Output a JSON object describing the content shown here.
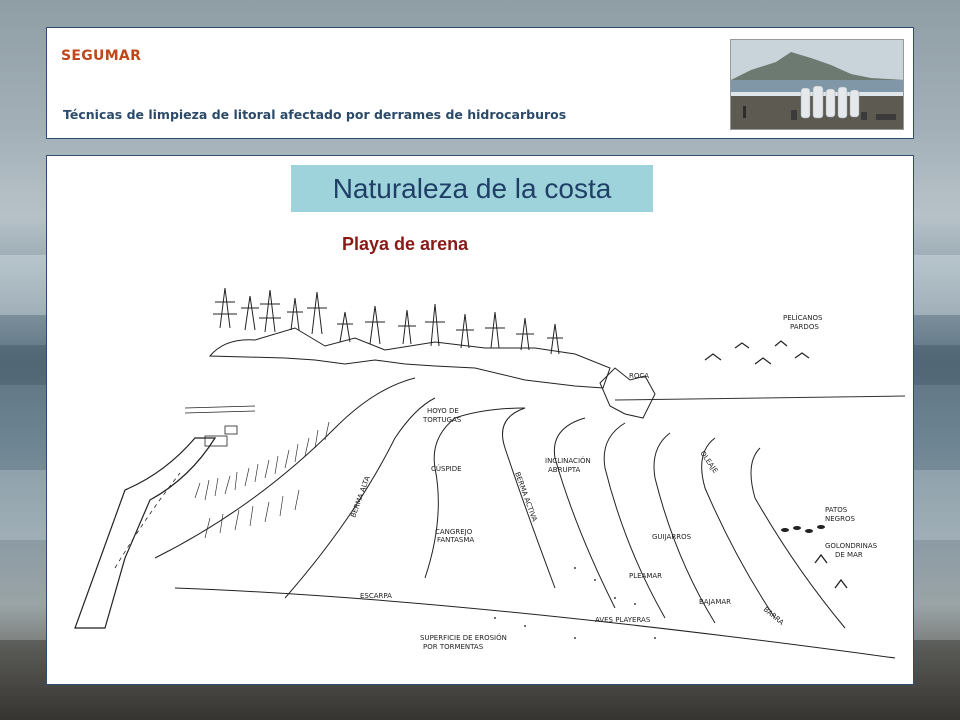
{
  "header": {
    "brand": "SEGUMAR",
    "subtitle": "Técnicas de limpieza de litoral afectado por derrames de hidrocarburos"
  },
  "main": {
    "title": "Naturaleza de la costa",
    "section_label": "Playa de arena"
  },
  "diagram_labels": {
    "pelicanos": "PELÍCANOS",
    "pardos": "PARDOS",
    "roca": "ROCA",
    "hoyo": "HOYO DE",
    "tortugas": "TORTUGAS",
    "cuspide": "CÚSPIDE",
    "berma_alta": "BERMA ALTA",
    "berma_activa": "BERMA ACTIVA",
    "inclinacion": "INCLINACIÓN",
    "abrupta": "ABRUPTA",
    "oleaje": "OLEAJE",
    "patos": "PATOS",
    "negros": "NEGROS",
    "guijarros": "GUIJARROS",
    "golondrinas": "GOLONDRINAS",
    "de_mar": "DE MAR",
    "cangrejo": "CANGREJO",
    "fantasma": "FANTASMA",
    "pleamar": "PLEAMAR",
    "escarpa": "ESCARPA",
    "bajamar": "BAJAMAR",
    "barra": "BARRA",
    "aves": "AVES PLAYERAS",
    "superficie": "SUPERFICIE DE EROSIÓN",
    "tormentas": "POR TORMENTAS"
  }
}
